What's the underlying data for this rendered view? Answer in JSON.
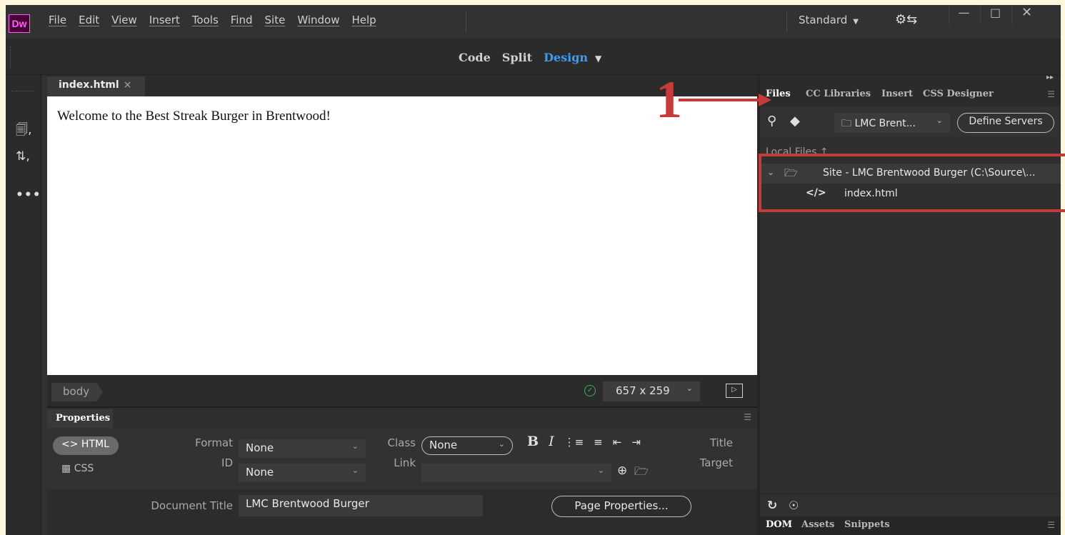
{
  "app": {
    "logo": "Dw",
    "menu": [
      "File",
      "Edit",
      "View",
      "Insert",
      "Tools",
      "Find",
      "Site",
      "Window",
      "Help"
    ],
    "workspace": "Standard",
    "window_controls": {
      "min": "minimize-icon",
      "max": "maximize-icon",
      "close": "close-icon"
    }
  },
  "views": {
    "code": "Code",
    "split": "Split",
    "design": "Design",
    "active": "Design"
  },
  "document": {
    "tab_label": "index.html",
    "content_heading": "Welcome to the Best Streak Burger in Brentwood!"
  },
  "statusbar": {
    "tag": "body",
    "size": "657 x 259"
  },
  "properties": {
    "panel_title": "Properties",
    "html_label": "HTML",
    "css_label": "CSS",
    "format_label": "Format",
    "format_value": "None",
    "id_label": "ID",
    "id_value": "None",
    "class_label": "Class",
    "class_value": "None",
    "link_label": "Link",
    "link_value": "",
    "title_label": "Title",
    "target_label": "Target",
    "doc_title_label": "Document Title",
    "doc_title_value": "LMC Brentwood Burger",
    "page_properties": "Page Properties..."
  },
  "files_panel": {
    "tabs": [
      "Files",
      "CC Libraries",
      "Insert",
      "CSS Designer"
    ],
    "active_tab": "Files",
    "site_select": "LMC Brent...",
    "define_servers": "Define Servers",
    "local_files_label": "Local Files",
    "tree": [
      {
        "label": "Site - LMC Brentwood Burger (C:\\Source\\...",
        "type": "site"
      },
      {
        "label": "index.html",
        "type": "file"
      }
    ],
    "bottom_tabs": [
      "DOM",
      "Assets",
      "Snippets"
    ]
  },
  "annotation": {
    "label": "1",
    "color": "#c73a3a"
  },
  "colors": {
    "accent": "#3f9cf5",
    "annotation": "#c73a3a",
    "logo_bg": "#470137",
    "logo_fg": "#ff61f6"
  }
}
